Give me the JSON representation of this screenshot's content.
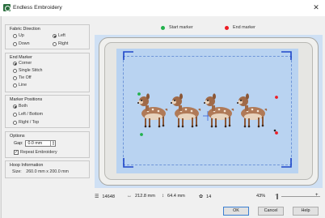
{
  "window": {
    "title": "Endless Embroidery",
    "close_glyph": "✕"
  },
  "fabric_direction": {
    "title": "Fabric Direction",
    "options": [
      {
        "label": "Up",
        "selected": false
      },
      {
        "label": "Left",
        "selected": true
      },
      {
        "label": "Down",
        "selected": false
      },
      {
        "label": "Right",
        "selected": false
      }
    ]
  },
  "end_marker": {
    "title": "End Marker",
    "options": [
      {
        "label": "Corner",
        "selected": true
      },
      {
        "label": "Single Stitch",
        "selected": false
      },
      {
        "label": "Tie Off",
        "selected": false
      },
      {
        "label": "Line",
        "selected": false
      }
    ]
  },
  "marker_positions": {
    "title": "Marker Positions",
    "options": [
      {
        "label": "Both",
        "selected": true
      },
      {
        "label": "Left / Bottom",
        "selected": false
      },
      {
        "label": "Right / Top",
        "selected": false
      }
    ]
  },
  "options_group": {
    "title": "Options",
    "gap_label": "Gap:",
    "gap_value": "0.0 mm",
    "repeat_label": "Repeat Embroidery",
    "repeat_checked": true
  },
  "hoop_info": {
    "title": "Hoop Information",
    "size_label": "Size:",
    "size_value": "260.0 mm x 200.0 mm"
  },
  "legend": {
    "start": {
      "label": "Start marker",
      "color": "#22b14c"
    },
    "end": {
      "label": "End marker",
      "color": "#ed1c24"
    }
  },
  "status": {
    "stitches": "14648",
    "width": "212.8 mm",
    "height": "64.4 mm",
    "colors": "14",
    "zoom": "43%",
    "zoom_minus": "−",
    "zoom_plus": "+"
  },
  "buttons": {
    "ok": "OK",
    "cancel": "Cancel",
    "help": "Help"
  },
  "colors": {
    "accent": "#1f47c9",
    "canvas_bg": "#cfe0f4"
  }
}
